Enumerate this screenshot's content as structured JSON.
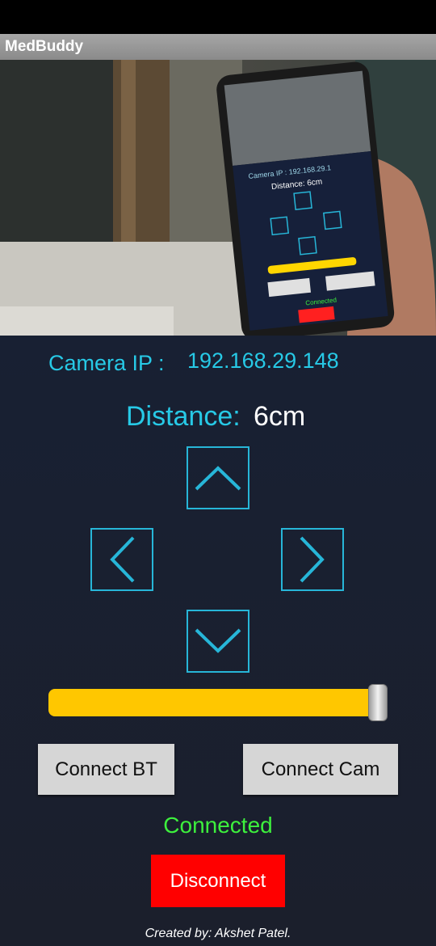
{
  "app": {
    "title": "MedBuddy"
  },
  "camera": {
    "ip_label": "Camera IP :",
    "ip_value": "192.168.29.148",
    "feed_icon": "camera-feed"
  },
  "distance": {
    "label": "Distance:",
    "value": "6cm"
  },
  "controls": {
    "up_icon": "chevron-up-icon",
    "down_icon": "chevron-down-icon",
    "left_icon": "chevron-left-icon",
    "right_icon": "chevron-right-icon"
  },
  "slider": {
    "level_percent": 100
  },
  "buttons": {
    "connect_bt": "Connect BT",
    "connect_cam": "Connect Cam",
    "disconnect": "Disconnect"
  },
  "status": {
    "text": "Connected"
  },
  "footer": {
    "credit": "Created by: Akshet Patel."
  },
  "colors": {
    "accent": "#27c9e6",
    "background": "#1b2030",
    "slider": "#ffc700",
    "status_ok": "#3df03d",
    "danger": "#ff0000",
    "button_gray": "#d6d6d6"
  }
}
